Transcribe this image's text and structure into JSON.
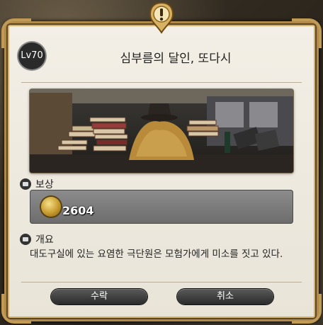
{
  "quest": {
    "level": "Lv70",
    "title": "심부름의 달인, 또다시"
  },
  "reward": {
    "label": "보상",
    "gil_amount": "2604",
    "icon": "gil-coin-icon"
  },
  "overview": {
    "label": "개요",
    "text": "대도구실에 있는 요염한 극단원은 모험가에게 미소를 짓고 있다."
  },
  "buttons": {
    "accept": "수락",
    "cancel": "취소"
  }
}
